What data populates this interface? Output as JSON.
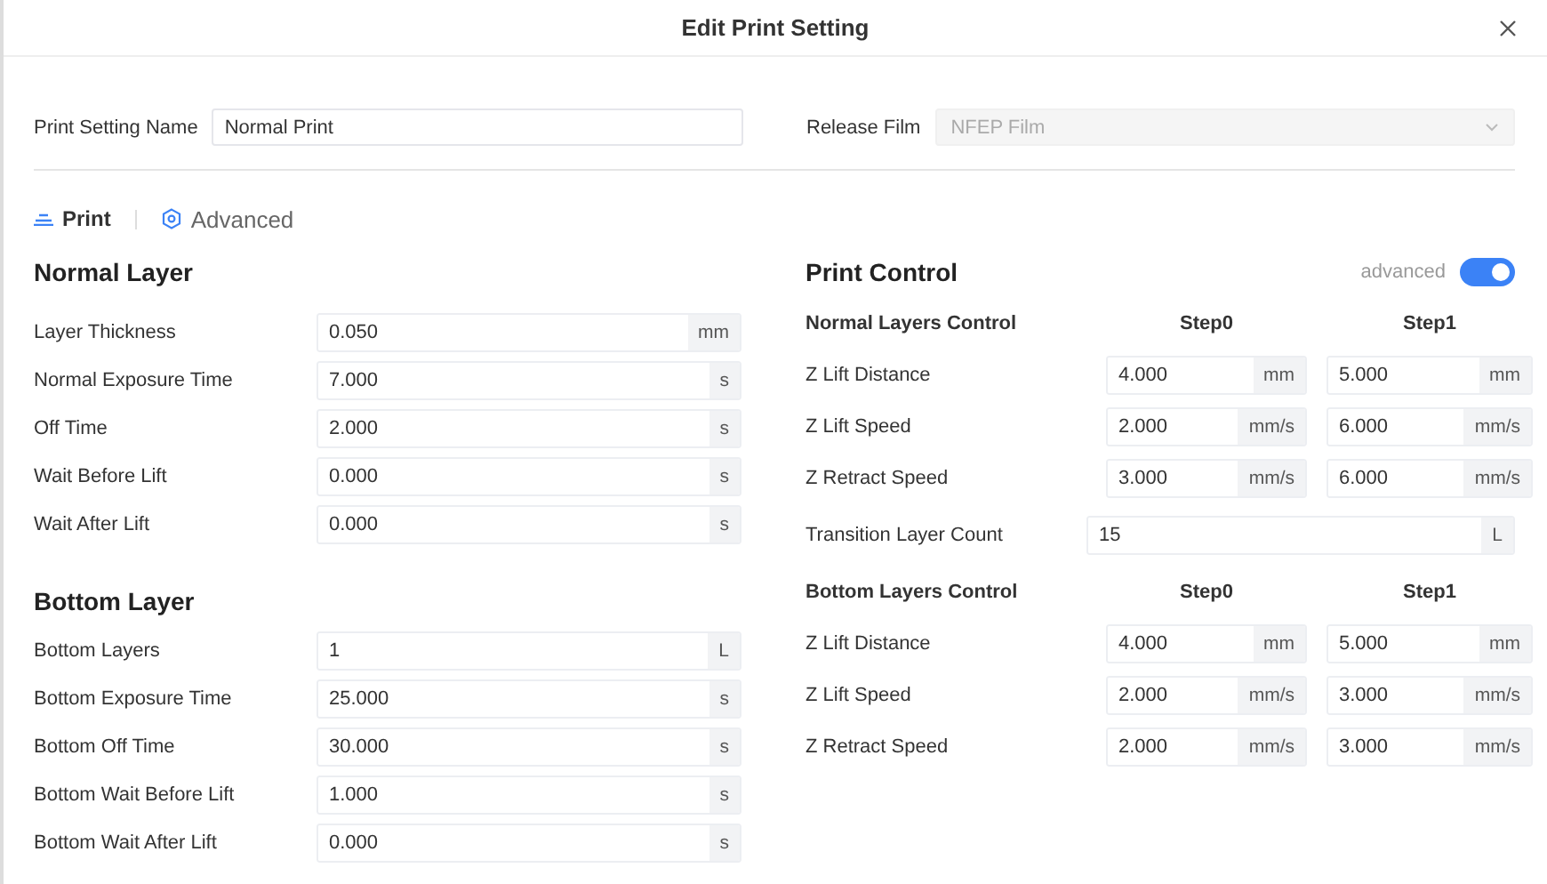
{
  "dialog": {
    "title": "Edit Print Setting"
  },
  "name_field": {
    "label": "Print Setting Name",
    "value": "Normal Print"
  },
  "release_film": {
    "label": "Release Film",
    "value": "NFEP Film",
    "disabled": true
  },
  "tabs": [
    {
      "label": "Print",
      "selected": true
    },
    {
      "label": "Advanced",
      "selected": false
    }
  ],
  "left_sections": [
    {
      "title": "Normal Layer",
      "rows": [
        {
          "label": "Layer Thickness",
          "value": "0.050",
          "unit": "mm"
        },
        {
          "label": "Normal Exposure Time",
          "value": "7.000",
          "unit": "s"
        },
        {
          "label": "Off Time",
          "value": "2.000",
          "unit": "s"
        },
        {
          "label": "Wait Before Lift",
          "value": "0.000",
          "unit": "s"
        },
        {
          "label": "Wait After Lift",
          "value": "0.000",
          "unit": "s"
        }
      ]
    },
    {
      "title": "Bottom Layer",
      "rows": [
        {
          "label": "Bottom Layers",
          "value": "1",
          "unit": "L"
        },
        {
          "label": "Bottom Exposure Time",
          "value": "25.000",
          "unit": "s"
        },
        {
          "label": "Bottom Off Time",
          "value": "30.000",
          "unit": "s"
        },
        {
          "label": "Bottom Wait Before Lift",
          "value": "1.000",
          "unit": "s"
        },
        {
          "label": "Bottom Wait After Lift",
          "value": "0.000",
          "unit": "s"
        }
      ]
    }
  ],
  "print_control": {
    "title": "Print Control",
    "toggle_label": "advanced",
    "toggle_on": true,
    "blocks": [
      {
        "kind": "group",
        "title": "Normal Layers Control",
        "steps": [
          "Step0",
          "Step1"
        ],
        "rows": [
          {
            "label": "Z Lift Distance",
            "cells": [
              {
                "value": "4.000",
                "unit": "mm"
              },
              {
                "value": "5.000",
                "unit": "mm"
              }
            ]
          },
          {
            "label": "Z Lift Speed",
            "cells": [
              {
                "value": "2.000",
                "unit": "mm/s"
              },
              {
                "value": "6.000",
                "unit": "mm/s"
              }
            ]
          },
          {
            "label": "Z Retract Speed",
            "cells": [
              {
                "value": "3.000",
                "unit": "mm/s"
              },
              {
                "value": "6.000",
                "unit": "mm/s"
              }
            ]
          }
        ]
      },
      {
        "kind": "single",
        "label": "Transition Layer Count",
        "value": "15",
        "unit": "L"
      },
      {
        "kind": "group",
        "title": "Bottom Layers Control",
        "steps": [
          "Step0",
          "Step1"
        ],
        "rows": [
          {
            "label": "Z Lift Distance",
            "cells": [
              {
                "value": "4.000",
                "unit": "mm"
              },
              {
                "value": "5.000",
                "unit": "mm"
              }
            ]
          },
          {
            "label": "Z Lift Speed",
            "cells": [
              {
                "value": "2.000",
                "unit": "mm/s"
              },
              {
                "value": "3.000",
                "unit": "mm/s"
              }
            ]
          },
          {
            "label": "Z Retract Speed",
            "cells": [
              {
                "value": "2.000",
                "unit": "mm/s"
              },
              {
                "value": "3.000",
                "unit": "mm/s"
              }
            ]
          }
        ]
      }
    ]
  }
}
